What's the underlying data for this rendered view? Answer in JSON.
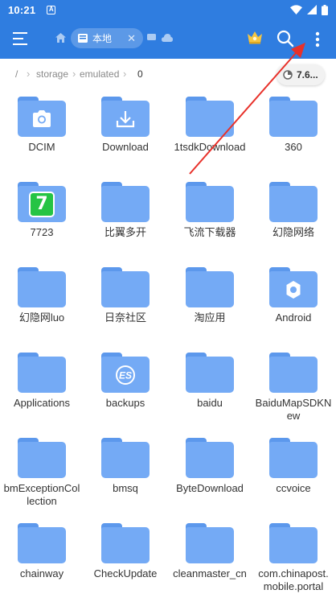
{
  "status_bar": {
    "time": "10:21",
    "app_indicator": "A"
  },
  "toolbar": {
    "location_tab": "本地"
  },
  "breadcrumb": {
    "items": [
      "/",
      "storage",
      "emulated",
      "0"
    ]
  },
  "storage_chip": {
    "value": "7.6..."
  },
  "files": [
    {
      "name": "DCIM",
      "emblem": "camera-icon"
    },
    {
      "name": "Download",
      "emblem": "download-icon"
    },
    {
      "name": "1tsdkDownload",
      "emblem": ""
    },
    {
      "name": "360",
      "emblem": ""
    },
    {
      "name": "7723",
      "emblem": "app-7723-icon"
    },
    {
      "name": "比翼多开",
      "emblem": ""
    },
    {
      "name": "飞流下载器",
      "emblem": ""
    },
    {
      "name": "幻隐网络",
      "emblem": ""
    },
    {
      "name": "幻隐网luo",
      "emblem": ""
    },
    {
      "name": "日奈社区",
      "emblem": ""
    },
    {
      "name": "淘应用",
      "emblem": ""
    },
    {
      "name": "Android",
      "emblem": "gear-icon"
    },
    {
      "name": "Applications",
      "emblem": ""
    },
    {
      "name": "backups",
      "emblem": "es-logo-icon"
    },
    {
      "name": "baidu",
      "emblem": ""
    },
    {
      "name": "BaiduMapSDKNew",
      "emblem": ""
    },
    {
      "name": "bmExceptionCollection",
      "emblem": ""
    },
    {
      "name": "bmsq",
      "emblem": ""
    },
    {
      "name": "ByteDownload",
      "emblem": ""
    },
    {
      "name": "ccvoice",
      "emblem": ""
    },
    {
      "name": "chainway",
      "emblem": ""
    },
    {
      "name": "CheckUpdate",
      "emblem": ""
    },
    {
      "name": "cleanmaster_cn",
      "emblem": ""
    },
    {
      "name": "com.chinapost.mobile.portal",
      "emblem": ""
    }
  ],
  "colors": {
    "toolbar": "#2f7de0",
    "folder": "#74aaf5",
    "folder_tab": "#5c98ec",
    "annotation": "#e8312a",
    "premium_crown": "#f5c542"
  }
}
